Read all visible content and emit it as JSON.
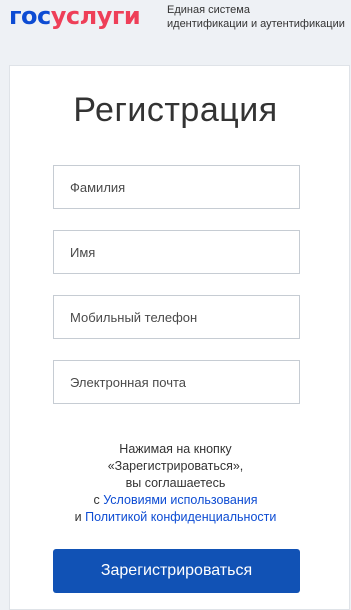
{
  "header": {
    "logo_part1": "гос",
    "logo_part2": "услуги",
    "tagline_line1": "Единая система",
    "tagline_line2": "идентификации и аутентификации"
  },
  "form": {
    "title": "Регистрация",
    "fields": [
      {
        "placeholder": "Фамилия",
        "value": ""
      },
      {
        "placeholder": "Имя",
        "value": ""
      },
      {
        "placeholder": "Мобильный телефон",
        "value": ""
      },
      {
        "placeholder": "Электронная почта",
        "value": ""
      }
    ],
    "notice": {
      "line1": "Нажимая на кнопку",
      "line2": "«Зарегистрироваться»,",
      "line3": "вы соглашаетесь",
      "prefix_terms": "с ",
      "terms_link": "Условиями использования",
      "prefix_privacy": "и ",
      "privacy_link": "Политикой конфиденциальности"
    },
    "submit_label": "Зарегистрироваться"
  },
  "colors": {
    "brand_blue": "#0d4cd3",
    "brand_red": "#ee3f58",
    "button_blue": "#1152b5",
    "background": "#eef1f5"
  }
}
